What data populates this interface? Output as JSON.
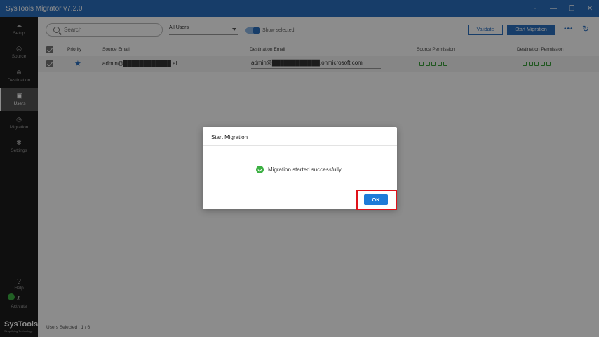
{
  "window": {
    "title": "SysTools Migrator v7.2.0"
  },
  "sidebar": {
    "items": [
      {
        "label": "Setup",
        "icon": "cloud-icon"
      },
      {
        "label": "Source",
        "icon": "target-icon"
      },
      {
        "label": "Destination",
        "icon": "crosshair-icon"
      },
      {
        "label": "Users",
        "icon": "user-card-icon"
      },
      {
        "label": "Migration",
        "icon": "clock-icon"
      },
      {
        "label": "Settings",
        "icon": "gear-icon"
      }
    ],
    "active": "Users",
    "help_label": "Help",
    "activate_label": "Activate",
    "brand_name": "SysTools",
    "brand_tagline": "Simplifying Technology"
  },
  "toolbar": {
    "search_placeholder": "Search",
    "filter_value": "All Users",
    "show_selected_label": "Show selected",
    "show_selected_on": true,
    "validate_label": "Validate",
    "start_migration_label": "Start Migration"
  },
  "table": {
    "columns": {
      "priority": "Priority",
      "source_email": "Source Email",
      "destination_email": "Destination Email",
      "source_permission": "Source Permission",
      "destination_permission": "Destination Permission"
    },
    "rows": [
      {
        "checked": true,
        "priority_starred": true,
        "source_email": "admin@████████████.al",
        "destination_email": "admin@████████████.onmicrosoft.com"
      }
    ]
  },
  "status": {
    "users_selected": "Users Selected : 1 / 6"
  },
  "dialog": {
    "title": "Start Migration",
    "message": "Migration started successfully.",
    "ok_label": "OK"
  },
  "colors": {
    "accent": "#2a6fc0",
    "sidebar_bg": "#1d1d1d",
    "success": "#3cb043",
    "highlight": "#e0121a"
  }
}
